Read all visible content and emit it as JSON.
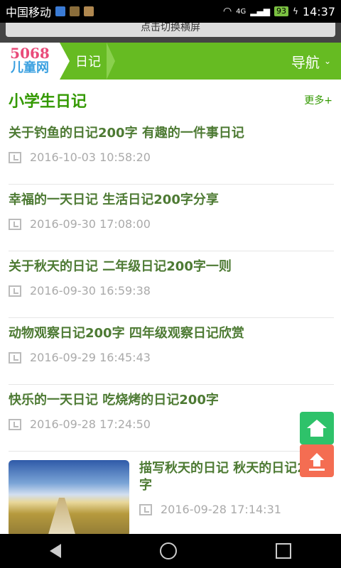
{
  "status_bar": {
    "carrier": "中国移动",
    "network": "4G",
    "battery": "93",
    "time": "14:37"
  },
  "landscape_button": "点击切换横屏",
  "header": {
    "logo_line1": "5068",
    "logo_line2": "儿童网",
    "breadcrumb": "日记",
    "nav_label": "导航"
  },
  "section": {
    "title": "小学生日记",
    "more": "更多+"
  },
  "items": [
    {
      "title": "关于钓鱼的日记200字 有趣的一件事日记",
      "date": "2016-10-03 10:58:20"
    },
    {
      "title": "幸福的一天日记 生活日记200字分享",
      "date": "2016-09-30 17:08:00"
    },
    {
      "title": "关于秋天的日记 二年级日记200字一则",
      "date": "2016-09-30 16:59:38"
    },
    {
      "title": "动物观察日记200字 四年级观察日记欣赏",
      "date": "2016-09-29 16:45:43"
    },
    {
      "title": "快乐的一天日记 吃烧烤的日记200字",
      "date": "2016-09-28 17:24:50"
    },
    {
      "title": "描写秋天的日记 秋天的日记200字",
      "date": "2016-09-28 17:14:31"
    }
  ],
  "colors": {
    "header_green": "#66bb22",
    "title_green": "#339900",
    "home_button": "#2ec26a",
    "top_button": "#f46d52"
  }
}
